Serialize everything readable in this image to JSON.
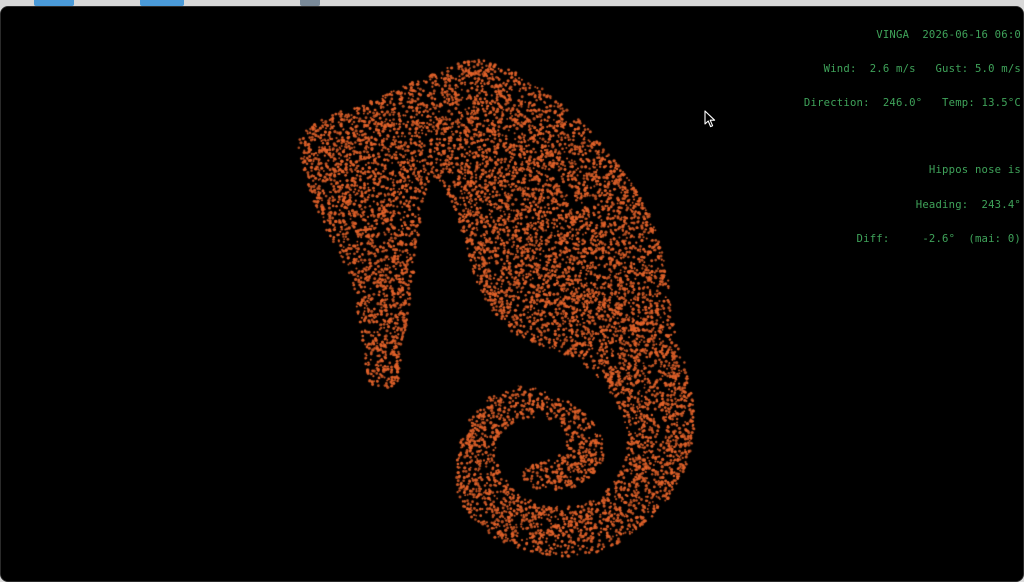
{
  "hud": {
    "title_line": "VINGA  2026-06-16 06:0",
    "wind_line": "Wind:  2.6 m/s   Gust: 5.0 m/s",
    "direction_line": "Direction:  246.0°   Temp: 13.5°C",
    "nose_line": "Hippos nose is",
    "heading_line": "Heading:  243.4°",
    "diff_line": "Diff:     -2.6°  (mai: 0)"
  },
  "colors": {
    "background": "#000000",
    "particle": "#e2622a",
    "hud_text": "#3fa35a"
  },
  "icons": {
    "cursor": "mouse-pointer-icon"
  }
}
